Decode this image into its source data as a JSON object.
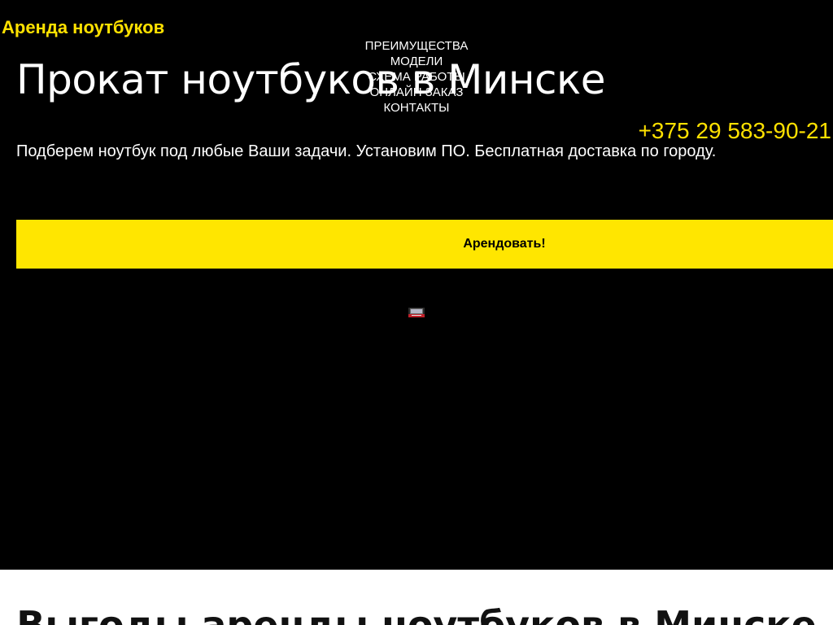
{
  "brand": {
    "name": "Аренда ноутбуков",
    "color": "#ffe100"
  },
  "nav": {
    "items": [
      {
        "label": "ПРЕИМУЩЕСТВА"
      },
      {
        "label": "МОДЕЛИ"
      },
      {
        "label": "СХЕМА РАБОТЫ"
      },
      {
        "label": "ОНЛАЙН ЗАКАЗ"
      },
      {
        "label": "КОНТАКТЫ"
      }
    ]
  },
  "hero": {
    "title": "Прокат ноутбуков в Минске",
    "subtitle": "Подберем ноутбук под любые Ваши задачи. Установим ПО. Бесплатная доставка по городу.",
    "phone": "+375 29 583-90-21",
    "cta_label": "Арендовать!",
    "background": "#000000",
    "accent": "#ffe600"
  },
  "benefits": {
    "title": "Выгоды аренды ноутбуков в Минске"
  }
}
